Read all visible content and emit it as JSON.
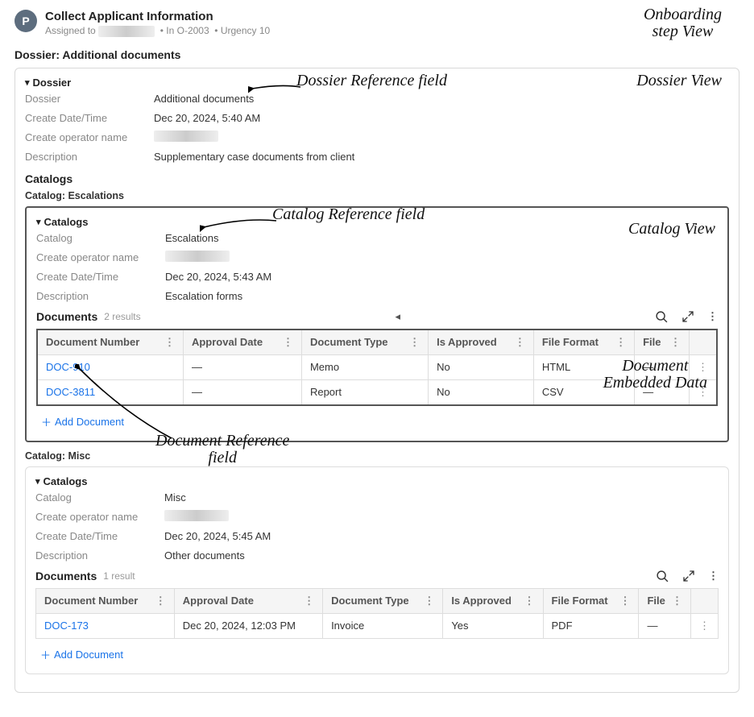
{
  "header": {
    "avatar_letter": "P",
    "title": "Collect Applicant Information",
    "assigned_prefix": "Assigned to",
    "in_text": "In O-2003",
    "urgency_text": "Urgency 10"
  },
  "dossier_heading": "Dossier: Additional documents",
  "dossier": {
    "section_label": "Dossier",
    "fields": {
      "dossier_label": "Dossier",
      "dossier_value": "Additional documents",
      "create_dt_label": "Create Date/Time",
      "create_dt_value": "Dec 20, 2024, 5:40 AM",
      "create_op_label": "Create operator name",
      "desc_label": "Description",
      "desc_value": "Supplementary case documents from client"
    },
    "catalogs_heading": "Catalogs"
  },
  "catalog1": {
    "heading": "Catalog: Escalations",
    "section_label": "Catalogs",
    "fields": {
      "catalog_label": "Catalog",
      "catalog_value": "Escalations",
      "create_op_label": "Create operator name",
      "create_dt_label": "Create Date/Time",
      "create_dt_value": "Dec 20, 2024, 5:43 AM",
      "desc_label": "Description",
      "desc_value": "Escalation forms"
    },
    "documents_label": "Documents",
    "results_text": "2 results",
    "columns": {
      "doc_num": "Document Number",
      "approval": "Approval Date",
      "doc_type": "Document Type",
      "approved": "Is Approved",
      "format": "File Format",
      "file": "File"
    },
    "rows": [
      {
        "doc_num": "DOC-910",
        "approval": "—",
        "doc_type": "Memo",
        "approved": "No",
        "format": "HTML",
        "file": "—"
      },
      {
        "doc_num": "DOC-3811",
        "approval": "—",
        "doc_type": "Report",
        "approved": "No",
        "format": "CSV",
        "file": "—"
      }
    ],
    "add_document": "Add Document"
  },
  "catalog2": {
    "heading": "Catalog: Misc",
    "section_label": "Catalogs",
    "fields": {
      "catalog_label": "Catalog",
      "catalog_value": "Misc",
      "create_op_label": "Create operator name",
      "create_dt_label": "Create Date/Time",
      "create_dt_value": "Dec 20, 2024, 5:45 AM",
      "desc_label": "Description",
      "desc_value": "Other documents"
    },
    "documents_label": "Documents",
    "results_text": "1 result",
    "columns": {
      "doc_num": "Document Number",
      "approval": "Approval Date",
      "doc_type": "Document Type",
      "approved": "Is Approved",
      "format": "File Format",
      "file": "File"
    },
    "rows": [
      {
        "doc_num": "DOC-173",
        "approval": "Dec 20, 2024, 12:03 PM",
        "doc_type": "Invoice",
        "approved": "Yes",
        "format": "PDF",
        "file": "—"
      }
    ],
    "add_document": "Add Document"
  },
  "annotations": {
    "onboarding": "Onboarding\nstep View",
    "dossier_ref": "Dossier Reference field",
    "dossier_view": "Dossier View",
    "catalog_ref": "Catalog Reference field",
    "catalog_view": "Catalog View",
    "doc_embedded": "Document\nEmbedded Data",
    "doc_ref": "Document Reference\nfield"
  },
  "icons": {
    "search": "search-icon",
    "expand": "expand-icon",
    "kebab": "kebab-icon",
    "plus": "plus-icon",
    "triangle": "triangle-left-icon"
  }
}
